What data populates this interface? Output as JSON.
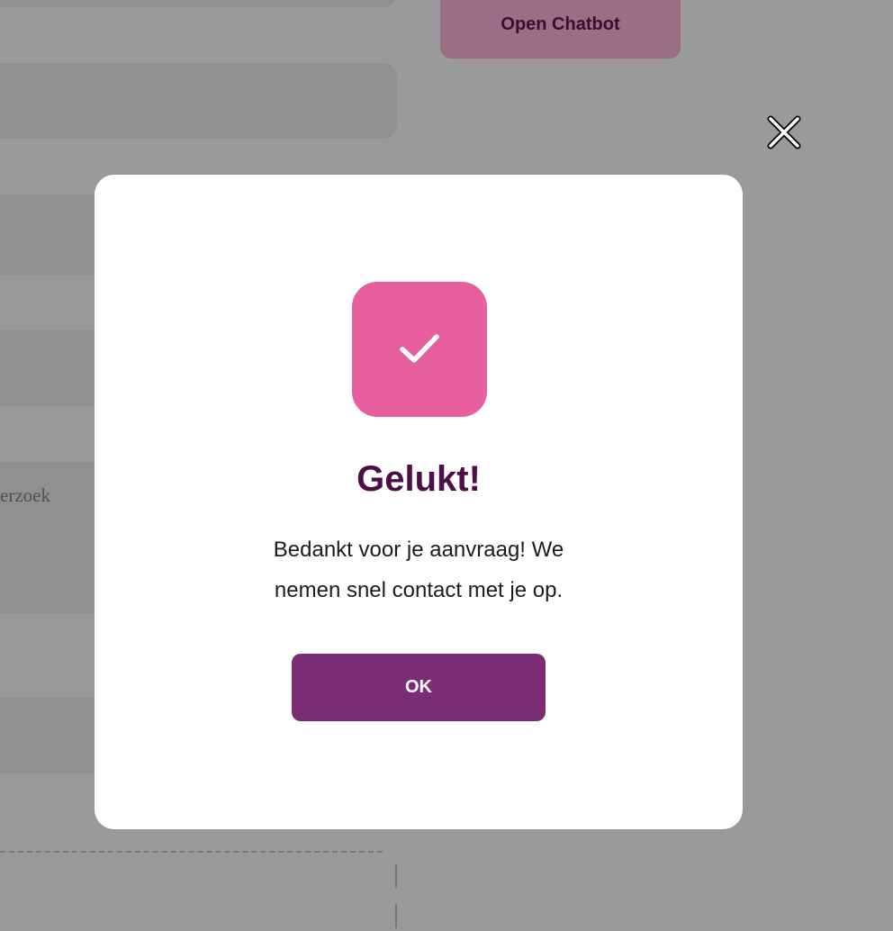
{
  "background": {
    "open_chatbot_label": "Open Chatbot",
    "partial_field_text": "erzoek"
  },
  "modal": {
    "icon": "checkmark-icon",
    "title": "Gelukt!",
    "message": "Bedankt voor je aanvraag! We nemen snel contact met je op.",
    "ok_label": "OK",
    "close_icon": "close-icon"
  },
  "colors": {
    "overlay": "#9a9a9a",
    "accent_pink": "#e85fa0",
    "title_purple": "#4d0f45",
    "button_purple": "#7b2d74",
    "chatbot_button": "#9c6e84"
  }
}
